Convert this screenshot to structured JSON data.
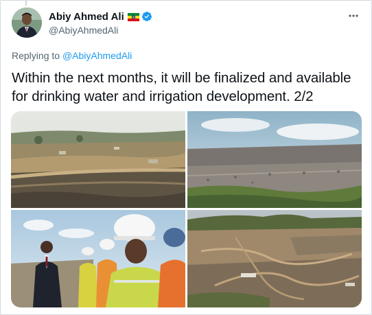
{
  "author": {
    "display_name": "Abiy Ahmed Ali",
    "handle": "@AbiyAhmedAli",
    "flag_icon": "ethiopia-flag-icon",
    "verified_icon": "verified-badge-icon"
  },
  "reply": {
    "prefix": "Replying to ",
    "target": "@AbiyAhmedAli"
  },
  "tweet": {
    "text": "Within the next months, it will be finalized and available for drinking water and irrigation development. 2/2"
  },
  "media": [
    {
      "name": "construction-site-photo"
    },
    {
      "name": "rock-fill-dam-photo"
    },
    {
      "name": "site-visit-workers-photo"
    },
    {
      "name": "aerial-reservoir-site-photo"
    }
  ],
  "colors": {
    "link": "#1d9bf0",
    "secondary_text": "#536471",
    "border": "#cfd9de"
  }
}
